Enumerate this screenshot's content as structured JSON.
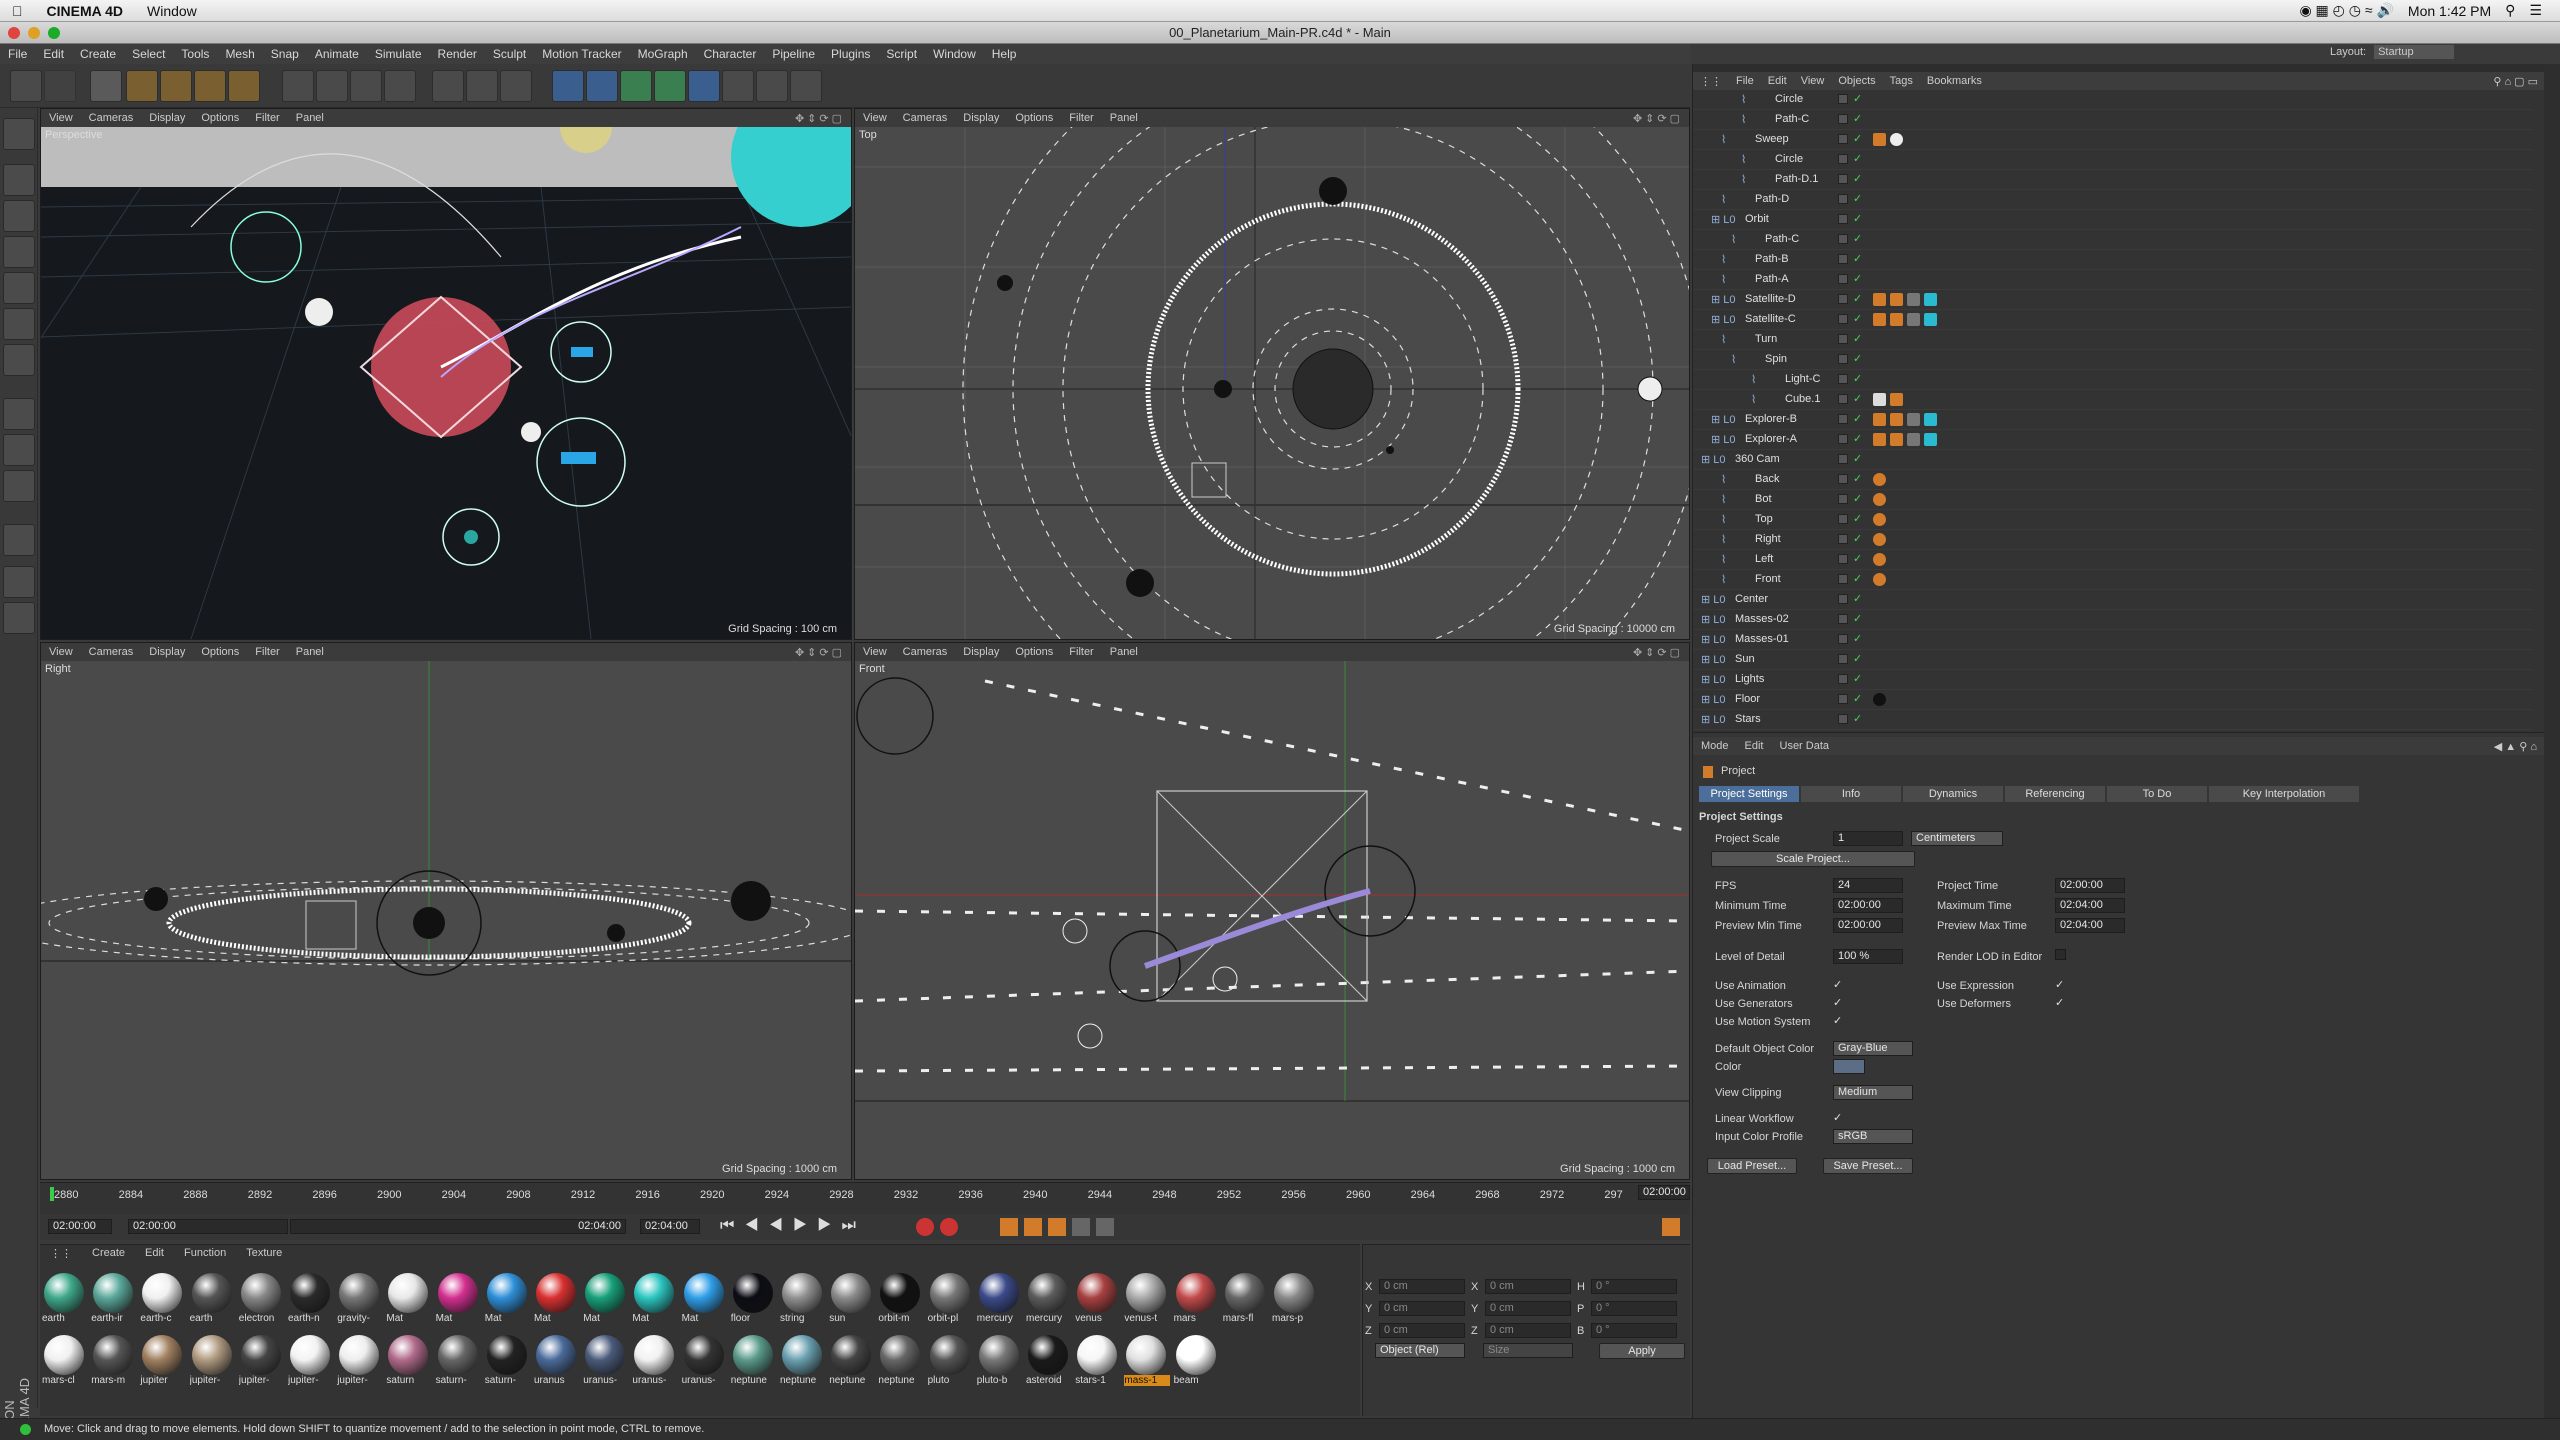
{
  "mac_menubar": {
    "app": "CINEMA 4D",
    "menu": "Window",
    "clock": "Mon 1:42 PM"
  },
  "window": {
    "title": "00_Planetarium_Main-PR.c4d * - Main"
  },
  "c4d_menu": [
    "File",
    "Edit",
    "Create",
    "Select",
    "Tools",
    "Mesh",
    "Snap",
    "Animate",
    "Simulate",
    "Render",
    "Sculpt",
    "Motion Tracker",
    "MoGraph",
    "Character",
    "Pipeline",
    "Plugins",
    "Script",
    "Window",
    "Help"
  ],
  "layout": {
    "label": "Layout:",
    "value": "Startup"
  },
  "viewport_menu": [
    "View",
    "Cameras",
    "Display",
    "Options",
    "Filter",
    "Panel"
  ],
  "viewports": {
    "perspective": {
      "label": "Perspective",
      "grid": "Grid Spacing : 100 cm"
    },
    "top": {
      "label": "Top",
      "grid": "Grid Spacing : 10000 cm"
    },
    "right": {
      "label": "Right",
      "grid": "Grid Spacing : 1000 cm"
    },
    "front": {
      "label": "Front",
      "grid": "Grid Spacing : 1000 cm"
    }
  },
  "objects_menu": [
    "File",
    "Edit",
    "View",
    "Objects",
    "Tags",
    "Bookmarks"
  ],
  "objects": [
    {
      "name": "Circle",
      "indent": 4
    },
    {
      "name": "Path-C",
      "indent": 4
    },
    {
      "name": "Sweep",
      "indent": 2
    },
    {
      "name": "Circle",
      "indent": 4
    },
    {
      "name": "Path-D.1",
      "indent": 4
    },
    {
      "name": "Path-D",
      "indent": 2
    },
    {
      "name": "Orbit",
      "indent": 1
    },
    {
      "name": "Path-C",
      "indent": 3
    },
    {
      "name": "Path-B",
      "indent": 2
    },
    {
      "name": "Path-A",
      "indent": 2
    },
    {
      "name": "Satellite-D",
      "indent": 1
    },
    {
      "name": "Satellite-C",
      "indent": 1
    },
    {
      "name": "Turn",
      "indent": 2
    },
    {
      "name": "Spin",
      "indent": 3
    },
    {
      "name": "Light-C",
      "indent": 5
    },
    {
      "name": "Cube.1",
      "indent": 5
    },
    {
      "name": "Explorer-B",
      "indent": 1
    },
    {
      "name": "Explorer-A",
      "indent": 1
    },
    {
      "name": "360 Cam",
      "indent": 0
    },
    {
      "name": "Back",
      "indent": 2
    },
    {
      "name": "Bot",
      "indent": 2
    },
    {
      "name": "Top",
      "indent": 2
    },
    {
      "name": "Right",
      "indent": 2
    },
    {
      "name": "Left",
      "indent": 2
    },
    {
      "name": "Front",
      "indent": 2
    },
    {
      "name": "Center",
      "indent": 0
    },
    {
      "name": "Masses-02",
      "indent": 0
    },
    {
      "name": "Masses-01",
      "indent": 0
    },
    {
      "name": "Sun",
      "indent": 0
    },
    {
      "name": "Lights",
      "indent": 0
    },
    {
      "name": "Floor",
      "indent": 0
    },
    {
      "name": "Stars",
      "indent": 0
    }
  ],
  "attributes": {
    "menu": [
      "Mode",
      "Edit",
      "User Data"
    ],
    "object": "Project",
    "tabs": [
      "Project Settings",
      "Info",
      "Dynamics",
      "Referencing",
      "To Do",
      "Key Interpolation"
    ],
    "section": "Project Settings",
    "project_scale_label": "Project Scale",
    "project_scale": "1",
    "units": "Centimeters",
    "scale_button": "Scale Project...",
    "fps_label": "FPS",
    "fps": "24",
    "project_time_label": "Project Time",
    "project_time": "02:00:00",
    "min_time_label": "Minimum Time",
    "min_time": "02:00:00",
    "max_time_label": "Maximum Time",
    "max_time": "02:04:00",
    "preview_min_label": "Preview Min Time",
    "preview_min": "02:00:00",
    "preview_max_label": "Preview Max Time",
    "preview_max": "02:04:00",
    "lod_label": "Level of Detail",
    "lod": "100 %",
    "render_lod_label": "Render LOD in Editor",
    "use_animation": "Use Animation",
    "use_expression": "Use Expression",
    "use_generators": "Use Generators",
    "use_deformers": "Use Deformers",
    "use_motion": "Use Motion System",
    "default_color_label": "Default Object Color",
    "default_color": "Gray-Blue",
    "color_label": "Color",
    "view_clipping_label": "View Clipping",
    "view_clipping": "Medium",
    "linear_workflow_label": "Linear Workflow",
    "input_profile_label": "Input Color Profile",
    "input_profile": "sRGB",
    "load_preset": "Load Preset...",
    "save_preset": "Save Preset..."
  },
  "timeline": {
    "ticks": [
      "2880",
      "2884",
      "2888",
      "2892",
      "2896",
      "2900",
      "2904",
      "2908",
      "2912",
      "2916",
      "2920",
      "2924",
      "2928",
      "2932",
      "2936",
      "2940",
      "2944",
      "2948",
      "2952",
      "2956",
      "2960",
      "2964",
      "2968",
      "2972",
      "297"
    ],
    "current_frame": "02:00:00",
    "start": "02:00:00",
    "range_start": "02:00:00",
    "range_end": "02:04:00",
    "end": "02:04:00"
  },
  "materials": {
    "menu": [
      "Create",
      "Edit",
      "Function",
      "Texture"
    ],
    "row1": [
      {
        "name": "earth",
        "color": "#3fa88a"
      },
      {
        "name": "earth-ir",
        "color": "#5aa79a"
      },
      {
        "name": "earth-c",
        "color": "#f0f0f0"
      },
      {
        "name": "earth",
        "color": "#555"
      },
      {
        "name": "electron",
        "color": "#888"
      },
      {
        "name": "earth-n",
        "color": "#2a2a2a"
      },
      {
        "name": "gravity-",
        "color": "#777"
      },
      {
        "name": "Mat",
        "color": "#e8e8e8"
      },
      {
        "name": "Mat",
        "color": "#d22f8f"
      },
      {
        "name": "Mat",
        "color": "#2e8fd8"
      },
      {
        "name": "Mat",
        "color": "#d83030"
      },
      {
        "name": "Mat",
        "color": "#17a07a"
      },
      {
        "name": "Mat",
        "color": "#2bc5c0"
      },
      {
        "name": "Mat",
        "color": "#2f9ee8"
      },
      {
        "name": "floor",
        "color": "#0c0c14"
      },
      {
        "name": "string",
        "color": "#909090"
      },
      {
        "name": "sun",
        "color": "#8a8a8a"
      },
      {
        "name": "orbit-m",
        "color": "#111"
      },
      {
        "name": "orbit-pl",
        "color": "#777"
      },
      {
        "name": "mercury",
        "color": "#3b4a8a"
      },
      {
        "name": "mercury",
        "color": "#5c5c5c"
      },
      {
        "name": "venus",
        "color": "#a84040"
      },
      {
        "name": "venus-t",
        "color": "#aaa"
      },
      {
        "name": "mars",
        "color": "#c24a4a"
      },
      {
        "name": "mars-fl",
        "color": "#666"
      },
      {
        "name": "mars-p",
        "color": "#888"
      }
    ],
    "row2": [
      {
        "name": "mars-cl",
        "color": "#f0f0f0"
      },
      {
        "name": "mars-m",
        "color": "#555"
      },
      {
        "name": "jupiter",
        "color": "#a08060"
      },
      {
        "name": "jupiter-",
        "color": "#b09a80"
      },
      {
        "name": "jupiter-",
        "color": "#444"
      },
      {
        "name": "jupiter-",
        "color": "#f2f2f2"
      },
      {
        "name": "jupiter-",
        "color": "#eee"
      },
      {
        "name": "saturn",
        "color": "#b06a8a"
      },
      {
        "name": "saturn-",
        "color": "#666"
      },
      {
        "name": "saturn-",
        "color": "#222"
      },
      {
        "name": "uranus",
        "color": "#4a6a9a"
      },
      {
        "name": "uranus-",
        "color": "#4a5a7a"
      },
      {
        "name": "uranus-",
        "color": "#f0f0f0"
      },
      {
        "name": "uranus-",
        "color": "#333"
      },
      {
        "name": "neptune",
        "color": "#5a9a8a"
      },
      {
        "name": "neptune",
        "color": "#6aa0b0"
      },
      {
        "name": "neptune",
        "color": "#444"
      },
      {
        "name": "neptune",
        "color": "#666"
      },
      {
        "name": "pluto",
        "color": "#555"
      },
      {
        "name": "pluto-b",
        "color": "#777"
      },
      {
        "name": "asteroid",
        "color": "#1a1a1a"
      },
      {
        "name": "stars-1",
        "color": "#f6f6f6"
      },
      {
        "name": "mass-1",
        "color": "#e0e0e0"
      },
      {
        "name": "beam",
        "color": "#ffffff"
      }
    ]
  },
  "coords": {
    "rows": [
      {
        "a": "X",
        "av": "0 cm",
        "b": "X",
        "bv": "0 cm",
        "c": "H",
        "cv": "0 °"
      },
      {
        "a": "Y",
        "av": "0 cm",
        "b": "Y",
        "bv": "0 cm",
        "c": "P",
        "cv": "0 °"
      },
      {
        "a": "Z",
        "av": "0 cm",
        "b": "Z",
        "bv": "0 cm",
        "c": "B",
        "cv": "0 °"
      }
    ],
    "mode": "Object (Rel)",
    "size": "Size",
    "apply": "Apply"
  },
  "status": "Move: Click and drag to move elements. Hold down SHIFT to quantize movement / add to the selection in point mode, CTRL to remove.",
  "colors": {
    "accent": "#4b6e9a",
    "check": "#4fd34f"
  }
}
